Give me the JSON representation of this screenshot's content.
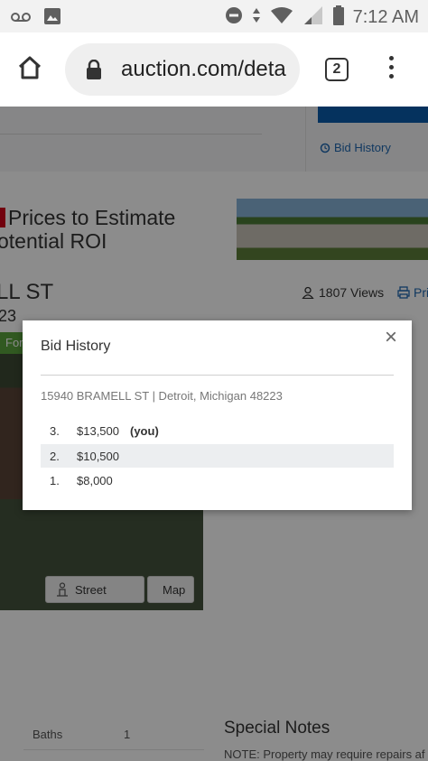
{
  "status_bar": {
    "time": "7:12 AM",
    "icons": [
      "voicemail-icon",
      "image-icon",
      "do-not-disturb-icon",
      "data-arrows-icon",
      "wifi-icon",
      "cell-signal-icon",
      "battery-icon"
    ]
  },
  "browser": {
    "url": "auction.com/deta",
    "tab_count": "2"
  },
  "page": {
    "bid_history_link": "Bid History",
    "promo_line1": "Prices to Estimate",
    "promo_line2": "otential ROI",
    "address_partial": "LL ST",
    "zip_partial": "23",
    "views": "1807 Views",
    "print_partial": "Pri",
    "for_sale_partial": "For",
    "street_button": "Street",
    "map_button": "Map",
    "baths_label": "Baths",
    "baths_value": "1",
    "special_notes_title": "Special Notes",
    "special_notes_text": "NOTE: Property may require repairs af"
  },
  "modal": {
    "title": "Bid History",
    "close_glyph": "×",
    "address": "15940 BRAMELL ST | Detroit, Michigan 48223",
    "bids": [
      {
        "rank": "3.",
        "amount": "$13,500",
        "tag": "(you)"
      },
      {
        "rank": "2.",
        "amount": "$10,500",
        "tag": ""
      },
      {
        "rank": "1.",
        "amount": "$8,000",
        "tag": ""
      }
    ]
  },
  "colors": {
    "accent_blue": "#1e66b0",
    "button_blue": "#0a5cab",
    "promo_red": "#d0021b",
    "for_sale_green": "#5aa33c",
    "overlay": "rgba(0,0,0,0.45)"
  }
}
